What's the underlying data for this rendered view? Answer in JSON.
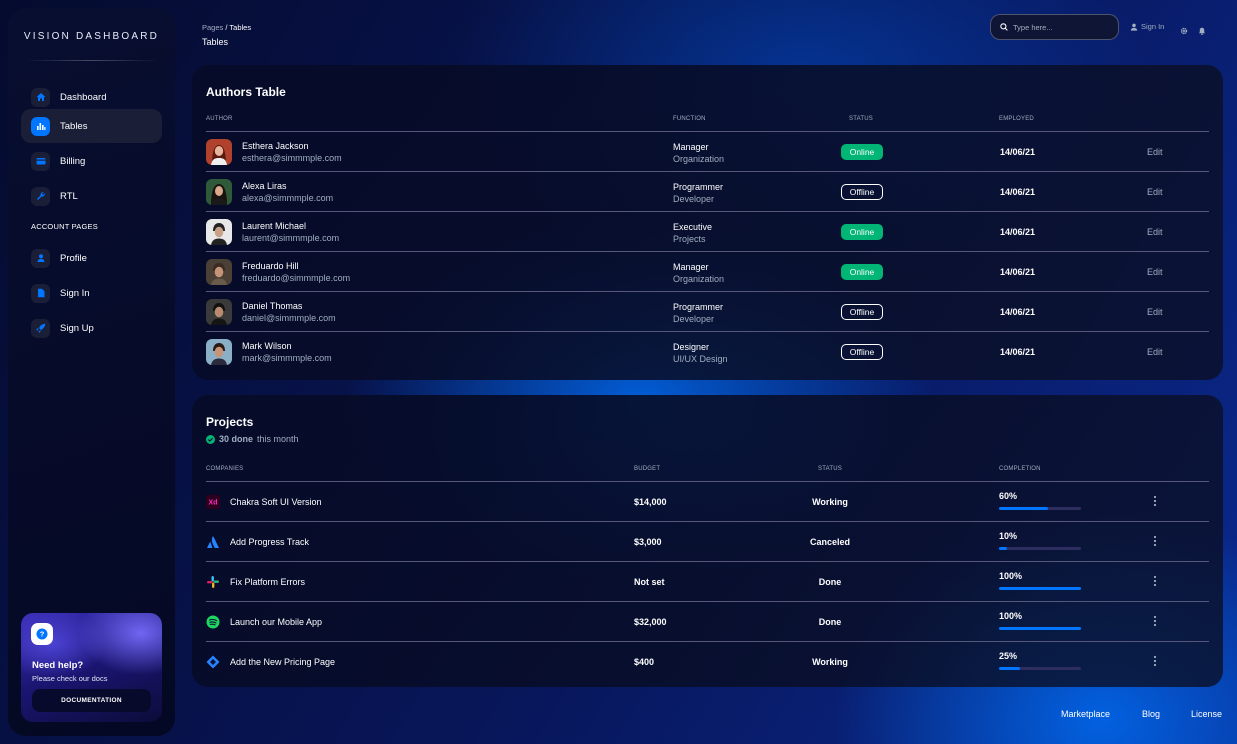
{
  "sidebar": {
    "brand": "VISION DASHBOARD",
    "items": [
      {
        "label": "Dashboard",
        "icon": "home-icon"
      },
      {
        "label": "Tables",
        "icon": "chart-bar-icon",
        "active": true
      },
      {
        "label": "Billing",
        "icon": "credit-card-icon"
      },
      {
        "label": "RTL",
        "icon": "wrench-icon"
      }
    ],
    "section_label": "ACCOUNT PAGES",
    "account_items": [
      {
        "label": "Profile",
        "icon": "person-icon"
      },
      {
        "label": "Sign In",
        "icon": "document-icon"
      },
      {
        "label": "Sign Up",
        "icon": "rocket-icon"
      }
    ],
    "help": {
      "title": "Need help?",
      "subtitle": "Please check our docs",
      "button": "DOCUMENTATION"
    }
  },
  "header": {
    "breadcrumb_root": "Pages",
    "breadcrumb_sep": " / ",
    "breadcrumb_current": "Tables",
    "page_title": "Tables",
    "search_placeholder": "Type here...",
    "signin_label": "Sign In"
  },
  "authors": {
    "title": "Authors Table",
    "columns": [
      "AUTHOR",
      "FUNCTION",
      "STATUS",
      "EMPLOYED"
    ],
    "edit_label": "Edit",
    "rows": [
      {
        "name": "Esthera Jackson",
        "email": "esthera@simmmple.com",
        "role": "Manager",
        "dept": "Organization",
        "status": "Online",
        "date": "14/06/21"
      },
      {
        "name": "Alexa Liras",
        "email": "alexa@simmmple.com",
        "role": "Programmer",
        "dept": "Developer",
        "status": "Offline",
        "date": "14/06/21"
      },
      {
        "name": "Laurent Michael",
        "email": "laurent@simmmple.com",
        "role": "Executive",
        "dept": "Projects",
        "status": "Online",
        "date": "14/06/21"
      },
      {
        "name": "Freduardo Hill",
        "email": "freduardo@simmmple.com",
        "role": "Manager",
        "dept": "Organization",
        "status": "Online",
        "date": "14/06/21"
      },
      {
        "name": "Daniel Thomas",
        "email": "daniel@simmmple.com",
        "role": "Programmer",
        "dept": "Developer",
        "status": "Offline",
        "date": "14/06/21"
      },
      {
        "name": "Mark Wilson",
        "email": "mark@simmmple.com",
        "role": "Designer",
        "dept": "UI/UX Design",
        "status": "Offline",
        "date": "14/06/21"
      }
    ]
  },
  "projects": {
    "title": "Projects",
    "done_count": "30 done",
    "done_suffix": "this month",
    "columns": [
      "COMPANIES",
      "BUDGET",
      "STATUS",
      "COMPLETION"
    ],
    "rows": [
      {
        "name": "Chakra Soft UI Version",
        "logo": "adobe-xd-icon",
        "budget": "$14,000",
        "status": "Working",
        "completion": "60%",
        "progress": 60
      },
      {
        "name": "Add Progress Track",
        "logo": "atlassian-icon",
        "budget": "$3,000",
        "status": "Canceled",
        "completion": "10%",
        "progress": 10
      },
      {
        "name": "Fix Platform Errors",
        "logo": "slack-icon",
        "budget": "Not set",
        "status": "Done",
        "completion": "100%",
        "progress": 100
      },
      {
        "name": "Launch our Mobile App",
        "logo": "spotify-icon",
        "budget": "$32,000",
        "status": "Done",
        "completion": "100%",
        "progress": 100
      },
      {
        "name": "Add the New Pricing Page",
        "logo": "jira-icon",
        "budget": "$400",
        "status": "Working",
        "completion": "25%",
        "progress": 25
      }
    ]
  },
  "footer": {
    "links": [
      "Marketplace",
      "Blog",
      "License"
    ]
  },
  "colors": {
    "accent": "#0075ff",
    "online": "#01b574",
    "muted": "#a0aec0"
  }
}
